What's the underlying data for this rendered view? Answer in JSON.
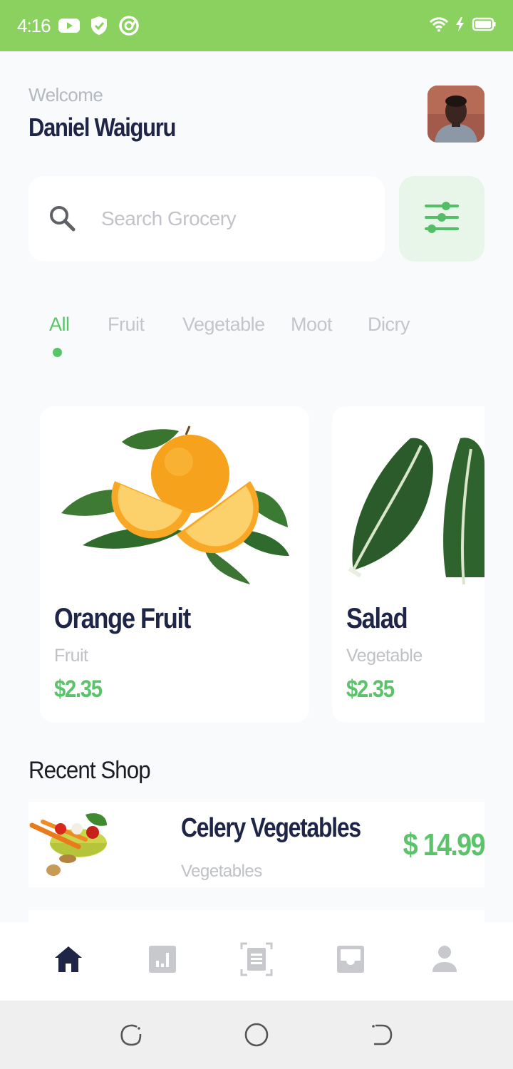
{
  "status_bar": {
    "time": "4:16",
    "left_icons": [
      "youtube-icon",
      "shield-check-icon",
      "at-sign-icon"
    ],
    "right_icons": [
      "wifi-icon",
      "charging-icon",
      "battery-icon"
    ],
    "background": "#8bd160"
  },
  "header": {
    "welcome": "Welcome",
    "user_name": "Daniel Waiguru"
  },
  "search": {
    "placeholder": "Search Grocery",
    "value": ""
  },
  "tabs": [
    {
      "label": "All",
      "active": true
    },
    {
      "label": "Fruit",
      "active": false
    },
    {
      "label": "Vegetable",
      "active": false
    },
    {
      "label": "Moot",
      "active": false
    },
    {
      "label": "Dicry",
      "active": false
    }
  ],
  "products": [
    {
      "name": "Orange Fruit",
      "category": "Fruit",
      "price": "$2.35"
    },
    {
      "name": "Salad",
      "category": "Vegetable",
      "price": "$2.35"
    }
  ],
  "recent": {
    "title": "Recent Shop",
    "items": [
      {
        "name": "Celery Vegetables",
        "category": "Vegetables",
        "price": "$ 14.99"
      }
    ]
  },
  "bottom_nav": [
    {
      "icon": "home-icon",
      "active": true
    },
    {
      "icon": "chart-icon",
      "active": false
    },
    {
      "icon": "scan-document-icon",
      "active": false
    },
    {
      "icon": "inbox-icon",
      "active": false
    },
    {
      "icon": "profile-icon",
      "active": false
    }
  ],
  "colors": {
    "accent": "#5bc46b",
    "navy": "#1f2547",
    "muted": "#bfc1c6"
  }
}
